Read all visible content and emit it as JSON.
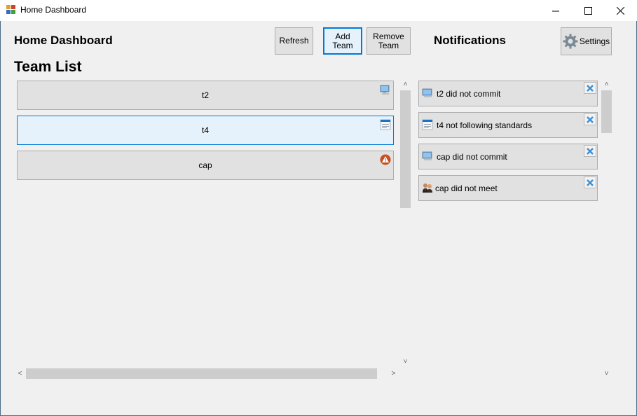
{
  "window": {
    "title": "Home Dashboard",
    "minimize_glyph": "—",
    "maximize_glyph": "☐",
    "close_glyph": "✕"
  },
  "header": {
    "title": "Home Dashboard",
    "section_title": "Team List",
    "notifications_title": "Notifications"
  },
  "toolbar": {
    "refresh_label": "Refresh",
    "add_team_line1": "Add",
    "add_team_line2": "Team",
    "remove_team_line1": "Remove",
    "remove_team_line2": "Team",
    "settings_label": "Settings"
  },
  "teams": [
    {
      "name": "t2",
      "icon": "monitor-icon"
    },
    {
      "name": "t4",
      "icon": "document-icon"
    },
    {
      "name": "cap",
      "icon": "warning-icon"
    }
  ],
  "notifications": [
    {
      "text": "t2 did not commit",
      "icon": "monitor-icon"
    },
    {
      "text": "t4 not following standards",
      "icon": "document-icon"
    },
    {
      "text": "cap did not commit",
      "icon": "monitor-icon"
    },
    {
      "text": "cap did not meet",
      "icon": "people-icon"
    }
  ],
  "scroll_glyphs": {
    "up": "˄",
    "down": "˅",
    "left": "<",
    "right": ">"
  },
  "colors": {
    "accent": "#0078d7",
    "warning": "#c8501e",
    "close_x": "#3c8fd6",
    "background": "#f0f0f0"
  }
}
